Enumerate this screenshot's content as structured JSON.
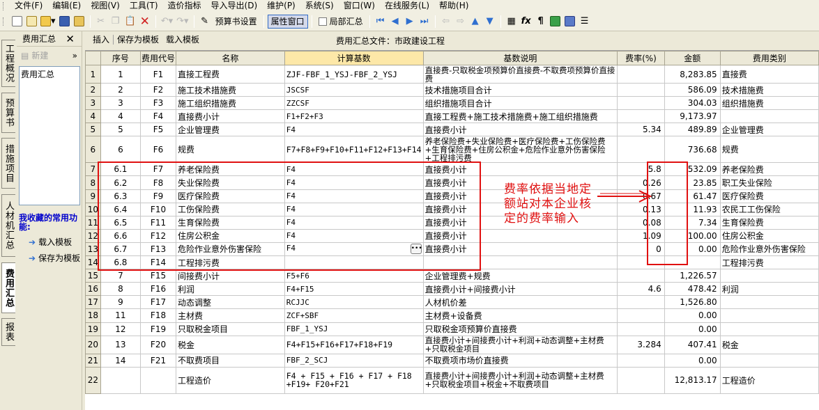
{
  "menubar": {
    "items": [
      "文件(F)",
      "编辑(E)",
      "视图(V)",
      "工具(T)",
      "造价指标",
      "导入导出(D)",
      "维护(P)",
      "系统(S)",
      "窗口(W)",
      "在线服务(L)",
      "帮助(H)"
    ]
  },
  "toolbar": {
    "budget_settings": "预算书设置",
    "attr_window": "属性窗口",
    "partial_summary": "局部汇总"
  },
  "lefttabs": [
    "工程概况",
    "预算书",
    "措施项目",
    "人材机汇总",
    "费用汇总",
    "报表"
  ],
  "leftpanel": {
    "title": "费用汇总",
    "new_label": "新建",
    "tree_item": "费用汇总",
    "fav_title": "我收藏的常用功能:",
    "fav_items": [
      "载入模板",
      "保存为模板"
    ]
  },
  "subbar": {
    "insert": "插入",
    "save_template": "保存为模板",
    "load_template": "载入模板",
    "file_title": "费用汇总文件：市政建设工程"
  },
  "columns": [
    "序号",
    "费用代号",
    "名称",
    "计算基数",
    "基数说明",
    "费率(%)",
    "金额",
    "费用类别"
  ],
  "rows": [
    {
      "n": "1",
      "seq": "1",
      "code": "F1",
      "name": "直接工程费",
      "basis": "ZJF-FBF_1_YSJ-FBF_2_YSJ",
      "desc": "直接费-只取税金项预算价直接费-不取费项预算价直接费",
      "rate": "",
      "amount": "8,283.85",
      "cat": "直接费"
    },
    {
      "n": "2",
      "seq": "2",
      "code": "F2",
      "name": "施工技术措施费",
      "basis": "JSCSF",
      "desc": "技术措施项目合计",
      "rate": "",
      "amount": "586.09",
      "cat": "技术措施费"
    },
    {
      "n": "3",
      "seq": "3",
      "code": "F3",
      "name": "施工组织措施费",
      "basis": "ZZCSF",
      "desc": "组织措施项目合计",
      "rate": "",
      "amount": "304.03",
      "cat": "组织措施费"
    },
    {
      "n": "4",
      "seq": "4",
      "code": "F4",
      "name": "直接费小计",
      "basis": "F1+F2+F3",
      "desc": "直接工程费+施工技术措施费+施工组织措施费",
      "rate": "",
      "amount": "9,173.97",
      "cat": ""
    },
    {
      "n": "5",
      "seq": "5",
      "code": "F5",
      "name": "企业管理费",
      "basis": "F4",
      "desc": "直接费小计",
      "rate": "5.34",
      "amount": "489.89",
      "cat": "企业管理费"
    },
    {
      "n": "6",
      "seq": "6",
      "code": "F6",
      "name": "规费",
      "basis": "F7+F8+F9+F10+F11+F12+F13+F14",
      "desc": "养老保险费+失业保险费+医疗保险费+工伤保险费+生育保险费+住房公积金+危险作业意外伤害保险+工程排污费",
      "rate": "",
      "amount": "736.68",
      "cat": "规费"
    },
    {
      "n": "7",
      "seq": "6.1",
      "code": "F7",
      "name": "养老保险费",
      "basis": "F4",
      "desc": "直接费小计",
      "rate": "5.8",
      "amount": "532.09",
      "cat": "养老保险费"
    },
    {
      "n": "8",
      "seq": "6.2",
      "code": "F8",
      "name": "失业保险费",
      "basis": "F4",
      "desc": "直接费小计",
      "rate": "0.26",
      "amount": "23.85",
      "cat": "职工失业保险"
    },
    {
      "n": "9",
      "seq": "6.3",
      "code": "F9",
      "name": "医疗保险费",
      "basis": "F4",
      "desc": "直接费小计",
      "rate": "0.67",
      "amount": "61.47",
      "cat": "医疗保险费"
    },
    {
      "n": "10",
      "seq": "6.4",
      "code": "F10",
      "name": "工伤保险费",
      "basis": "F4",
      "desc": "直接费小计",
      "rate": "0.13",
      "amount": "11.93",
      "cat": "农民工工伤保险"
    },
    {
      "n": "11",
      "seq": "6.5",
      "code": "F11",
      "name": "生育保险费",
      "basis": "F4",
      "desc": "直接费小计",
      "rate": "0.08",
      "amount": "7.34",
      "cat": "生育保险费"
    },
    {
      "n": "12",
      "seq": "6.6",
      "code": "F12",
      "name": "住房公积金",
      "basis": "F4",
      "desc": "直接费小计",
      "rate": "1.09",
      "amount": "100.00",
      "cat": "住房公积金"
    },
    {
      "n": "13",
      "seq": "6.7",
      "code": "F13",
      "name": "危险作业意外伤害保险",
      "basis": "F4",
      "desc": "直接费小计",
      "rate": "0",
      "amount": "0.00",
      "cat": "危险作业意外伤害保险"
    },
    {
      "n": "14",
      "seq": "6.8",
      "code": "F14",
      "name": "工程排污费",
      "basis": "",
      "desc": "",
      "rate": "",
      "amount": "",
      "cat": "工程排污费"
    },
    {
      "n": "15",
      "seq": "7",
      "code": "F15",
      "name": "间接费小计",
      "basis": "F5+F6",
      "desc": "企业管理费+规费",
      "rate": "",
      "amount": "1,226.57",
      "cat": ""
    },
    {
      "n": "16",
      "seq": "8",
      "code": "F16",
      "name": "利润",
      "basis": "F4+F15",
      "desc": "直接费小计+间接费小计",
      "rate": "4.6",
      "amount": "478.42",
      "cat": "利润"
    },
    {
      "n": "17",
      "seq": "9",
      "code": "F17",
      "name": "动态调整",
      "basis": "RCJJC",
      "desc": "人材机价差",
      "rate": "",
      "amount": "1,526.80",
      "cat": ""
    },
    {
      "n": "18",
      "seq": "11",
      "code": "F18",
      "name": "主材费",
      "basis": "ZCF+SBF",
      "desc": "主材费+设备费",
      "rate": "",
      "amount": "0.00",
      "cat": ""
    },
    {
      "n": "19",
      "seq": "12",
      "code": "F19",
      "name": "只取税金项目",
      "basis": "FBF_1_YSJ",
      "desc": "只取税金项预算价直接费",
      "rate": "",
      "amount": "0.00",
      "cat": ""
    },
    {
      "n": "20",
      "seq": "13",
      "code": "F20",
      "name": "税金",
      "basis": "F4+F15+F16+F17+F18+F19",
      "desc": "直接费小计+间接费小计+利润+动态调整+主材费+只取税金项目",
      "rate": "3.284",
      "amount": "407.41",
      "cat": "税金"
    },
    {
      "n": "21",
      "seq": "14",
      "code": "F21",
      "name": "不取费项目",
      "basis": "FBF_2_SCJ",
      "desc": "不取费项市场价直接费",
      "rate": "",
      "amount": "0.00",
      "cat": ""
    },
    {
      "n": "22",
      "seq": "",
      "code": "",
      "name": "工程造价",
      "basis": "F4 + F15 + F16 + F17 + F18 +F19+ F20+F21",
      "desc": "直接费小计+间接费小计+利润+动态调整+主材费+只取税金项目+税金+不取费项目",
      "rate": "",
      "amount": "12,813.17",
      "cat": "工程造价"
    }
  ],
  "annotation": "费率依据当地定额站对本企业核定的费率输入"
}
